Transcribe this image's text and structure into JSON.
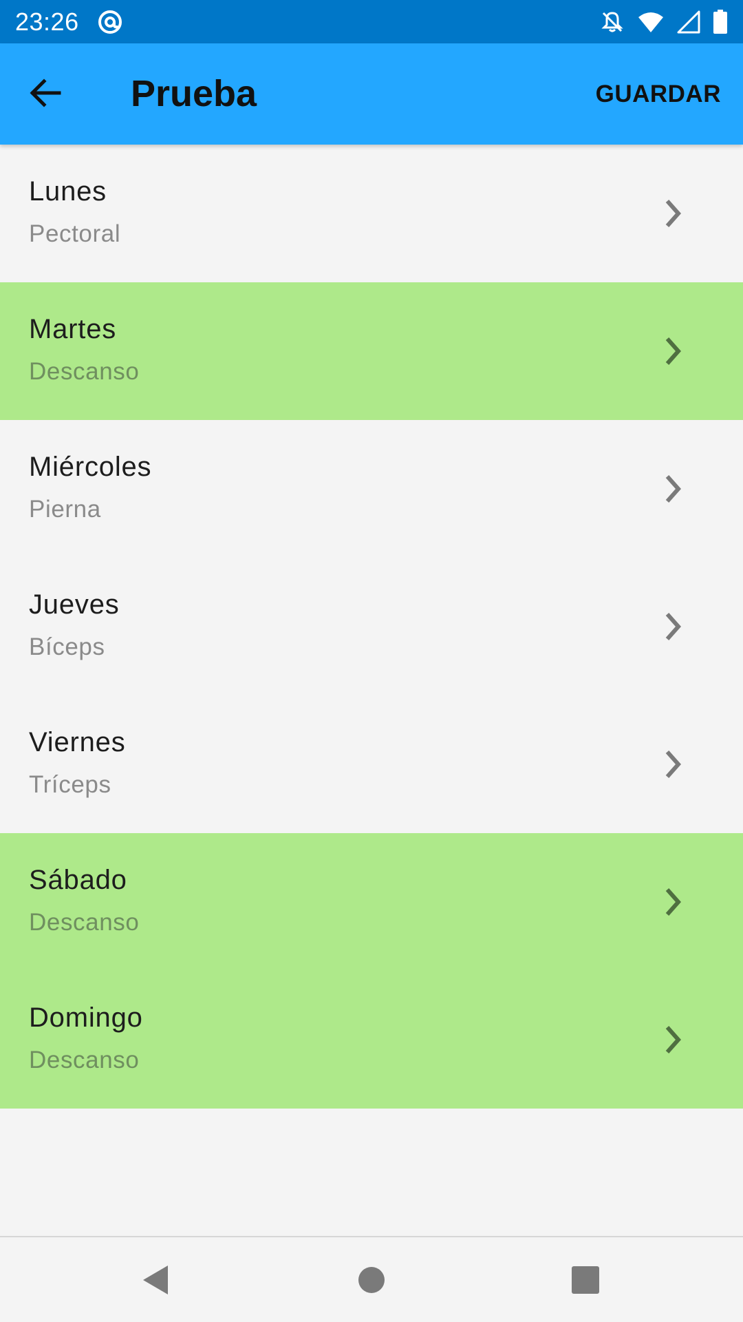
{
  "status_bar": {
    "time": "23:26"
  },
  "app_bar": {
    "title": "Prueba",
    "save_label": "GUARDAR",
    "background_color": "#23a7ff"
  },
  "days": [
    {
      "name": "Lunes",
      "subtitle": "Pectoral",
      "rest": false
    },
    {
      "name": "Martes",
      "subtitle": "Descanso",
      "rest": true
    },
    {
      "name": "Miércoles",
      "subtitle": "Pierna",
      "rest": false
    },
    {
      "name": "Jueves",
      "subtitle": "Bíceps",
      "rest": false
    },
    {
      "name": "Viernes",
      "subtitle": "Tríceps",
      "rest": false
    },
    {
      "name": "Sábado",
      "subtitle": "Descanso",
      "rest": true
    },
    {
      "name": "Domingo",
      "subtitle": "Descanso",
      "rest": true
    }
  ],
  "colors": {
    "status_bar": "#0077c8",
    "rest_day_highlight": "#aee98a",
    "list_background": "#f4f4f4"
  },
  "icons": {
    "back": "arrow-back-icon",
    "chevron": "chevron-right-icon",
    "nav_back": "nav-back-icon",
    "nav_home": "nav-home-icon",
    "nav_recents": "nav-recents-icon"
  }
}
